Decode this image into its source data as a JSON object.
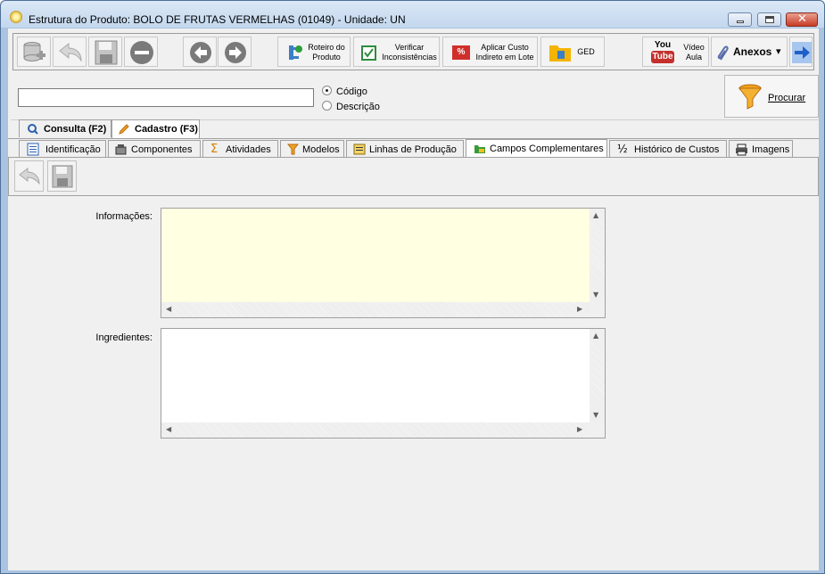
{
  "window": {
    "title": "Estrutura do Produto: BOLO DE FRUTAS VERMELHAS  (01049)   - Unidade: UN",
    "close_glyph": "✕"
  },
  "toolbar": {
    "roteiro": [
      "Roteiro do",
      "Produto"
    ],
    "verificar": [
      "Verificar",
      "Inconsistências"
    ],
    "aplicar": [
      "Aplicar Custo",
      "Indireto em Lote"
    ],
    "percent_badge": "%",
    "ged": "GED",
    "youtube_top": "You",
    "youtube_bottom": "Tube",
    "video": [
      "Vídeo",
      "Aula"
    ],
    "anexos": "Anexos",
    "anexos_caret": "▾"
  },
  "search": {
    "value": "",
    "radio_codigo": "Código",
    "radio_descricao": "Descrição",
    "selected": "Código",
    "procurar": "Procurar"
  },
  "main_tabs": [
    {
      "label": "Consulta (F2)",
      "active": false
    },
    {
      "label": "Cadastro (F3)",
      "active": true
    }
  ],
  "sub_tabs": [
    {
      "label": "Identificação"
    },
    {
      "label": "Componentes"
    },
    {
      "label": "Atividades"
    },
    {
      "label": "Modelos"
    },
    {
      "label": "Linhas de Produção"
    },
    {
      "label": "Campos Complementares",
      "active": true
    },
    {
      "label": "Histórico de Custos"
    },
    {
      "label": "Imagens"
    }
  ],
  "sigma_glyph": "Σ",
  "half_glyph": "½",
  "form": {
    "informacoes_label": "Informações:",
    "informacoes_value": "",
    "ingredientes_label": "Ingredientes:",
    "ingredientes_value": ""
  },
  "scroll_glyphs": {
    "up": "▲",
    "down": "▼",
    "left": "◀",
    "right": "▶"
  },
  "colors": {
    "memo_active_bg": "#ffffe1",
    "youtube_red": "#c4302b",
    "tab_active_accent": "#3a7bd5"
  }
}
